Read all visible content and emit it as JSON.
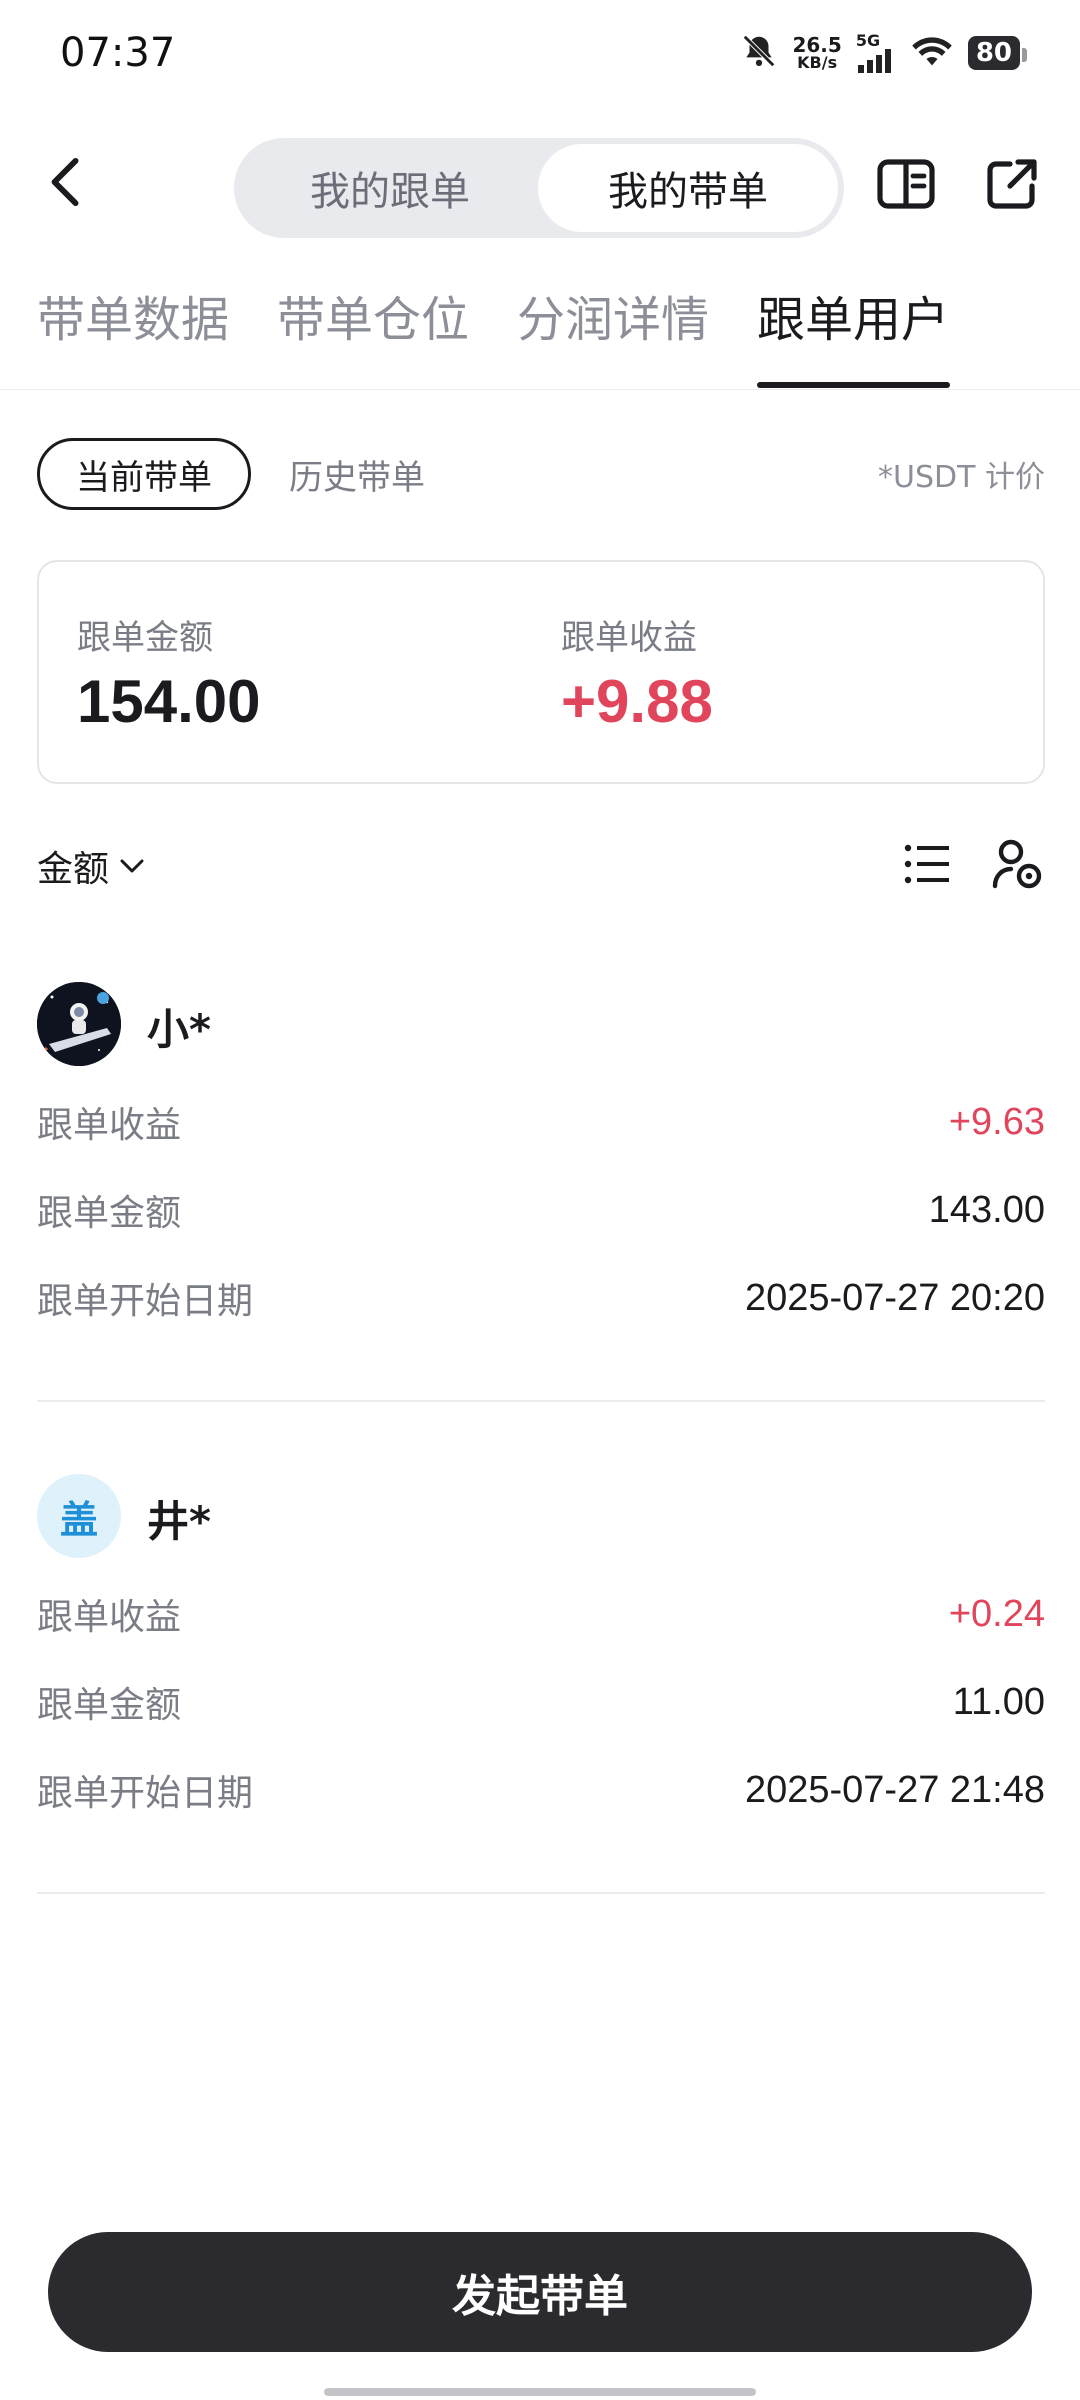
{
  "status_bar": {
    "time": "07:37",
    "net_speed_value": "26.5",
    "net_speed_unit": "KB/s",
    "network": "5G",
    "battery": "80"
  },
  "header": {
    "segments": [
      "我的跟单",
      "我的带单"
    ],
    "active_segment": "我的带单"
  },
  "tabs": [
    {
      "label": "带单数据"
    },
    {
      "label": "带单仓位"
    },
    {
      "label": "分润详情"
    },
    {
      "label": "跟单用户"
    }
  ],
  "active_tab": "跟单用户",
  "filters": {
    "current": "当前带单",
    "history": "历史带单",
    "unit_note": "*USDT 计价"
  },
  "summary": {
    "amount_label": "跟单金额",
    "amount_value": "154.00",
    "profit_label": "跟单收益",
    "profit_value": "+9.88"
  },
  "sort": {
    "label": "金额"
  },
  "followers": [
    {
      "name": "小*",
      "avatar": "astronaut-avatar",
      "profit_label": "跟单收益",
      "profit": "+9.63",
      "amount_label": "跟单金额",
      "amount": "143.00",
      "start_label": "跟单开始日期",
      "start": "2025-07-27 20:20"
    },
    {
      "name": "井*",
      "avatar_text": "盖",
      "profit_label": "跟单收益",
      "profit": "+0.24",
      "amount_label": "跟单金额",
      "amount": "11.00",
      "start_label": "跟单开始日期",
      "start": "2025-07-27 21:48"
    }
  ],
  "cta": {
    "label": "发起带单"
  },
  "colors": {
    "positive": "#e0455b",
    "primary_dark": "#2b2b2f"
  }
}
